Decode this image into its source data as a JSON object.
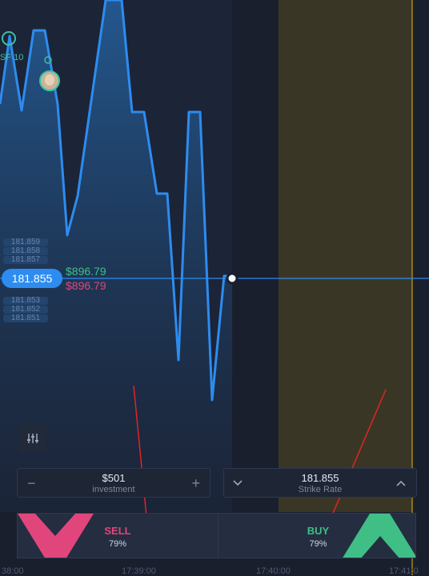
{
  "chart": {
    "price_ladder_above": [
      "181.859",
      "181.858",
      "181.857"
    ],
    "price_ladder_below": [
      "181.853",
      "181.852",
      "181.851"
    ],
    "current_price": "181.855",
    "payout_up": "$896.79",
    "payout_down": "$896.79",
    "marker_label": "SF 10",
    "colors": {
      "line": "#2d8cf0",
      "expiry_zone": "#3a3626",
      "expiry_line": "#e6b800",
      "price_line": "#2d8cf0",
      "sell": "#e0467c",
      "buy": "#3fbf86"
    }
  },
  "investment": {
    "value": "$501",
    "label": "investment",
    "minus": "−",
    "plus": "+"
  },
  "strike": {
    "value": "181.855",
    "label": "Strike Rate",
    "down_icon": "chevron-down-icon",
    "up_icon": "chevron-up-icon"
  },
  "trade": {
    "sell_label": "SELL",
    "sell_pct": "79%",
    "buy_label": "BUY",
    "buy_pct": "79%"
  },
  "time_axis": [
    "38:00",
    "17:39:00",
    "17:40:00",
    "17:41:0"
  ]
}
